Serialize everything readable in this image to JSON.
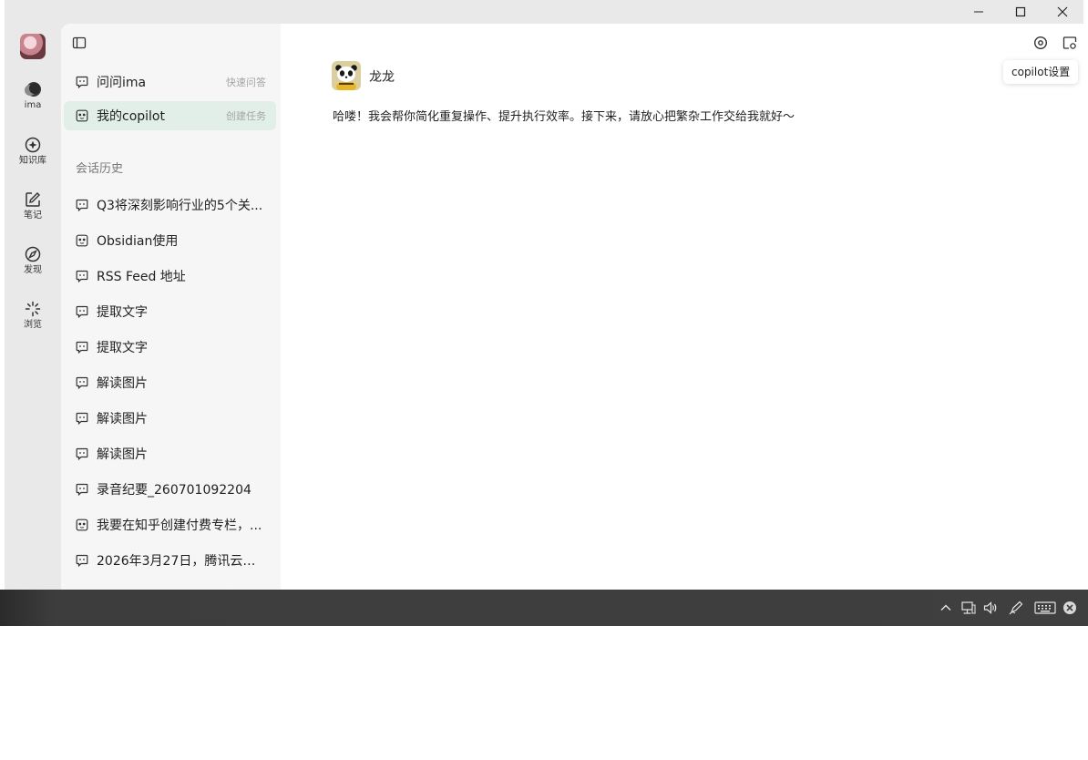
{
  "window": {
    "controls": {
      "minimize": "minimize-icon",
      "maximize": "maximize-icon",
      "close": "close-icon"
    }
  },
  "rail": {
    "items": [
      {
        "label": "ima",
        "icon": "ima-logo-icon"
      },
      {
        "label": "知识库",
        "icon": "knowledge-base-icon"
      },
      {
        "label": "笔记",
        "icon": "note-icon"
      },
      {
        "label": "发现",
        "icon": "compass-icon"
      },
      {
        "label": "浏览",
        "icon": "loading-spinner-icon"
      }
    ]
  },
  "sidebar": {
    "nav": [
      {
        "label": "问问ima",
        "hint": "快速问答",
        "icon": "chat-bubble-icon"
      },
      {
        "label": "我的copilot",
        "hint": "创建任务",
        "icon": "panda-bot-icon"
      }
    ],
    "history_title": "会话历史",
    "history": [
      {
        "label": "Q3将深刻影响行业的5个关...",
        "icon": "chat-bubble-icon"
      },
      {
        "label": "Obsidian使用",
        "icon": "panda-bot-icon"
      },
      {
        "label": "RSS Feed 地址",
        "icon": "chat-bubble-icon"
      },
      {
        "label": "提取文字",
        "icon": "chat-bubble-icon"
      },
      {
        "label": "提取文字",
        "icon": "chat-bubble-icon"
      },
      {
        "label": "解读图片",
        "icon": "chat-bubble-icon"
      },
      {
        "label": "解读图片",
        "icon": "chat-bubble-icon"
      },
      {
        "label": "解读图片",
        "icon": "chat-bubble-icon"
      },
      {
        "label": "录音纪要_260701092204",
        "icon": "chat-bubble-icon"
      },
      {
        "label": "我要在知乎创建付费专栏，...",
        "icon": "panda-bot-icon"
      },
      {
        "label": "2026年3月27日，腾讯云发...",
        "icon": "chat-bubble-icon"
      }
    ]
  },
  "main": {
    "bot_name": "龙龙",
    "greeting": "哈喽！我会帮你简化重复操作、提升执行效率。接下来，请放心把繁杂工作交给我就好～",
    "tooltip": "copilot设置",
    "top_icons": [
      "settings-icon",
      "new-window-icon"
    ]
  },
  "taskbar": {
    "tray_icons": [
      "chevron-up-icon",
      "network-icon",
      "volume-icon",
      "pen-icon",
      "keyboard-icon",
      "close-circle-icon"
    ]
  },
  "colors": {
    "active_nav_bg": "#e2efe8",
    "rail_bg": "#e9e9e9",
    "sidebar_bg": "#f6f6f6",
    "taskbar_bg": "#3f3f3f"
  }
}
